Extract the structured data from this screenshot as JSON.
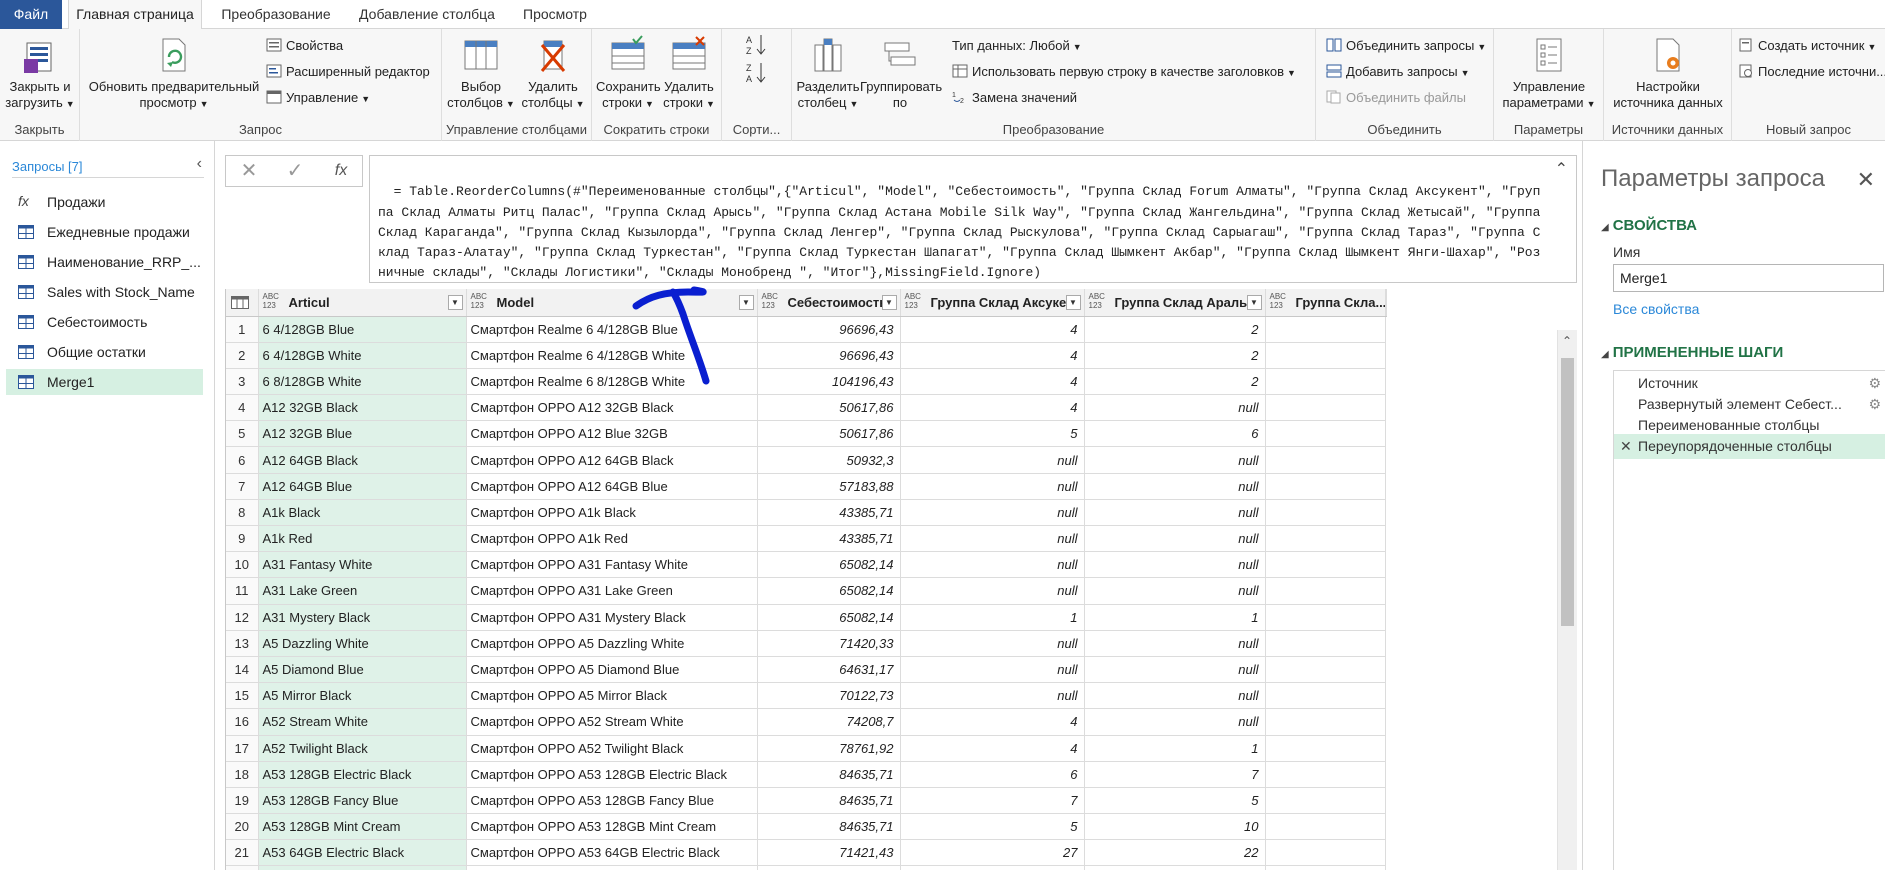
{
  "menu": {
    "tabs": [
      {
        "label": "Файл"
      },
      {
        "label": "Главная страница"
      },
      {
        "label": "Преобразование"
      },
      {
        "label": "Добавление столбца"
      },
      {
        "label": "Просмотр"
      }
    ]
  },
  "ribbon": {
    "close": {
      "button_line1": "Закрыть и",
      "button_line2": "загрузить",
      "group": "Закрыть"
    },
    "query": {
      "refresh_line1": "Обновить предварительный",
      "refresh_line2": "просмотр",
      "properties": "Свойства",
      "advanced_editor": "Расширенный редактор",
      "manage": "Управление",
      "group": "Запрос"
    },
    "columns": {
      "choose_line1": "Выбор",
      "choose_line2": "столбцов",
      "remove_line1": "Удалить",
      "remove_line2": "столбцы",
      "group": "Управление столбцами"
    },
    "rows": {
      "keep_line1": "Сохранить",
      "keep_line2": "строки",
      "remove_line1": "Удалить",
      "remove_line2": "строки",
      "group": "Сократить строки"
    },
    "sort": {
      "group": "Сорти..."
    },
    "transform": {
      "split_line1": "Разделить",
      "split_line2": "столбец",
      "group_line1": "Группировать",
      "group_line2": "по",
      "data_type": "Тип данных: Любой",
      "first_row_header": "Использовать первую строку в качестве заголовков",
      "replace_values": "Замена значений",
      "group": "Преобразование"
    },
    "combine": {
      "merge": "Объединить запросы",
      "append": "Добавить запросы",
      "combine_files": "Объединить файлы",
      "group": "Объединить"
    },
    "parameters": {
      "button_line1": "Управление",
      "button_line2": "параметрами",
      "group": "Параметры"
    },
    "datasources": {
      "button_line1": "Настройки",
      "button_line2": "источника данных",
      "group": "Источники данных"
    },
    "newquery": {
      "new_source": "Создать источник",
      "recent_sources": "Последние источни...",
      "group": "Новый запрос"
    }
  },
  "queries": {
    "title": "Запросы [7]",
    "items": [
      {
        "label": "Продажи",
        "icon": "function-icon"
      },
      {
        "label": "Ежедневные продажи",
        "icon": "table-icon"
      },
      {
        "label": "Наименование_RRP_...",
        "icon": "table-icon"
      },
      {
        "label": "Sales with Stock_Name",
        "icon": "table-icon"
      },
      {
        "label": "Себестоимость",
        "icon": "table-icon"
      },
      {
        "label": "Общие остатки",
        "icon": "table-icon"
      },
      {
        "label": "Merge1",
        "icon": "table-icon"
      }
    ]
  },
  "formula_bar": {
    "cancel": "✕",
    "commit": "✓",
    "fx": "fx",
    "text": "= Table.ReorderColumns(#\"Переименованные столбцы\",{\"Articul\", \"Model\", \"Себестоимость\", \"Группа Склад Forum Алматы\", \"Группа Склад Аксукент\", \"Группа Склад Алматы Ритц Палас\", \"Группа Склад Арысь\", \"Группа Склад Астана Mobile Silk Way\", \"Группа Склад Жангельдина\", \"Группа Склад Жетысай\", \"Группа Склад Караганда\", \"Группа Склад Кызылорда\", \"Группа Склад Ленгер\", \"Группа Склад Рыскулова\", \"Группа Склад Сарыагаш\", \"Группа Склад Тараз\", \"Группа Склад Тараз-Алатау\", \"Группа Склад Туркестан\", \"Группа Склад Туркестан Шапагат\", \"Группа Склад Шымкент Акбар\", \"Группа Склад Шымкент Янги-Шахар\", \"Розничные склады\", \"Склады Логистики\", \"Склады Монобренд \", \"Итог\"},MissingField.Ignore)"
  },
  "grid": {
    "type_label_top": "ABC",
    "type_label_bottom": "123",
    "headers": [
      "Articul",
      "Model",
      "Себестоимость",
      "Группа Склад Аксукент",
      "Группа Склад Аральск",
      "Группа Скла..."
    ],
    "rows": [
      [
        "1",
        "6 4/128GB Blue",
        "Смартфон Realme 6 4/128GB Blue",
        "96696,43",
        "4",
        "2"
      ],
      [
        "2",
        "6 4/128GB White",
        "Смартфон Realme 6 4/128GB White",
        "96696,43",
        "4",
        "2"
      ],
      [
        "3",
        "6 8/128GB White",
        "Смартфон Realme 6 8/128GB White",
        "104196,43",
        "4",
        "2"
      ],
      [
        "4",
        "A12 32GB Black",
        "Смартфон OPPO A12 32GB Black",
        "50617,86",
        "4",
        "null"
      ],
      [
        "5",
        "A12 32GB Blue",
        "Смартфон OPPO A12 Blue 32GB",
        "50617,86",
        "5",
        "6"
      ],
      [
        "6",
        "A12 64GB Black",
        "Смартфон OPPO A12 64GB Black",
        "50932,3",
        "null",
        "null"
      ],
      [
        "7",
        "A12 64GB Blue",
        "Смартфон OPPO A12 64GB Blue",
        "57183,88",
        "null",
        "null"
      ],
      [
        "8",
        "A1k Black",
        "Смартфон OPPO A1k Black",
        "43385,71",
        "null",
        "null"
      ],
      [
        "9",
        "A1k Red",
        "Смартфон OPPO A1k Red",
        "43385,71",
        "null",
        "null"
      ],
      [
        "10",
        "A31 Fantasy White",
        "Смартфон OPPO A31 Fantasy White",
        "65082,14",
        "null",
        "null"
      ],
      [
        "11",
        "A31 Lake Green",
        "Смартфон OPPO A31 Lake Green",
        "65082,14",
        "null",
        "null"
      ],
      [
        "12",
        "A31 Mystery Black",
        "Смартфон OPPO A31 Mystery Black",
        "65082,14",
        "1",
        "1"
      ],
      [
        "13",
        "A5 Dazzling White",
        "Смартфон OPPO A5 Dazzling White",
        "71420,33",
        "null",
        "null"
      ],
      [
        "14",
        "A5 Diamond Blue",
        "Смартфон OPPO A5 Diamond Blue",
        "64631,17",
        "null",
        "null"
      ],
      [
        "15",
        "A5 Mirror Black",
        "Смартфон OPPO A5 Mirror Black",
        "70122,73",
        "null",
        "null"
      ],
      [
        "16",
        "A52 Stream White",
        "Смартфон OPPO A52 Stream White",
        "74208,7",
        "4",
        "null"
      ],
      [
        "17",
        "A52 Twilight Black",
        "Смартфон OPPO A52 Twilight Black",
        "78761,92",
        "4",
        "1"
      ],
      [
        "18",
        "A53 128GB Electric Black",
        "Смартфон OPPO A53 128GB Electric Black",
        "84635,71",
        "6",
        "7"
      ],
      [
        "19",
        "A53 128GB Fancy Blue",
        "Смартфон OPPO A53 128GB Fancy Blue",
        "84635,71",
        "7",
        "5"
      ],
      [
        "20",
        "A53 128GB Mint Cream",
        "Смартфон OPPO A53 128GB Mint Cream",
        "84635,71",
        "5",
        "10"
      ],
      [
        "21",
        "A53 64GB Electric Black",
        "Смартфон OPPO A53 64GB Electric Black",
        "71421,43",
        "27",
        "22"
      ],
      [
        "22",
        "",
        "",
        "",
        "",
        ""
      ]
    ]
  },
  "settings": {
    "title": "Параметры запроса",
    "properties_header": "СВОЙСТВА",
    "name_label": "Имя",
    "name_value": "Merge1",
    "all_properties": "Все свойства",
    "steps_header": "ПРИМЕНЕННЫЕ ШАГИ",
    "steps": [
      {
        "label": "Источник"
      },
      {
        "label": "Развернутый элемент Себест..."
      },
      {
        "label": "Переименованные столбцы"
      },
      {
        "label": "Переупорядоченные столбцы"
      }
    ]
  },
  "colors": {
    "file_tab": "#2b579a",
    "selected_green": "#d6f0e2",
    "accent_green": "#217346",
    "link_blue": "#2b88d8",
    "annotation_blue": "#0a1fd0"
  }
}
